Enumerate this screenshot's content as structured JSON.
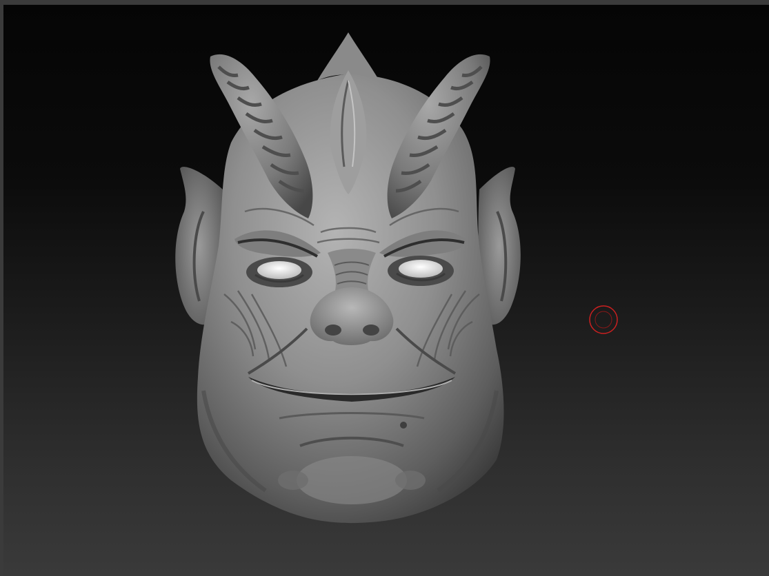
{
  "app": {
    "type": "3d-sculpting-viewport"
  },
  "canvas": {
    "model_icon": "sculpted-demon-head-icon",
    "brush_cursor_icon": "brush-circle-icon",
    "colors": {
      "background_top": "#050505",
      "background_bottom": "#3a3a3a",
      "frame": "#3b3b3b",
      "material": "#9a9a9a",
      "brush_cursor": "#cc2020"
    }
  }
}
